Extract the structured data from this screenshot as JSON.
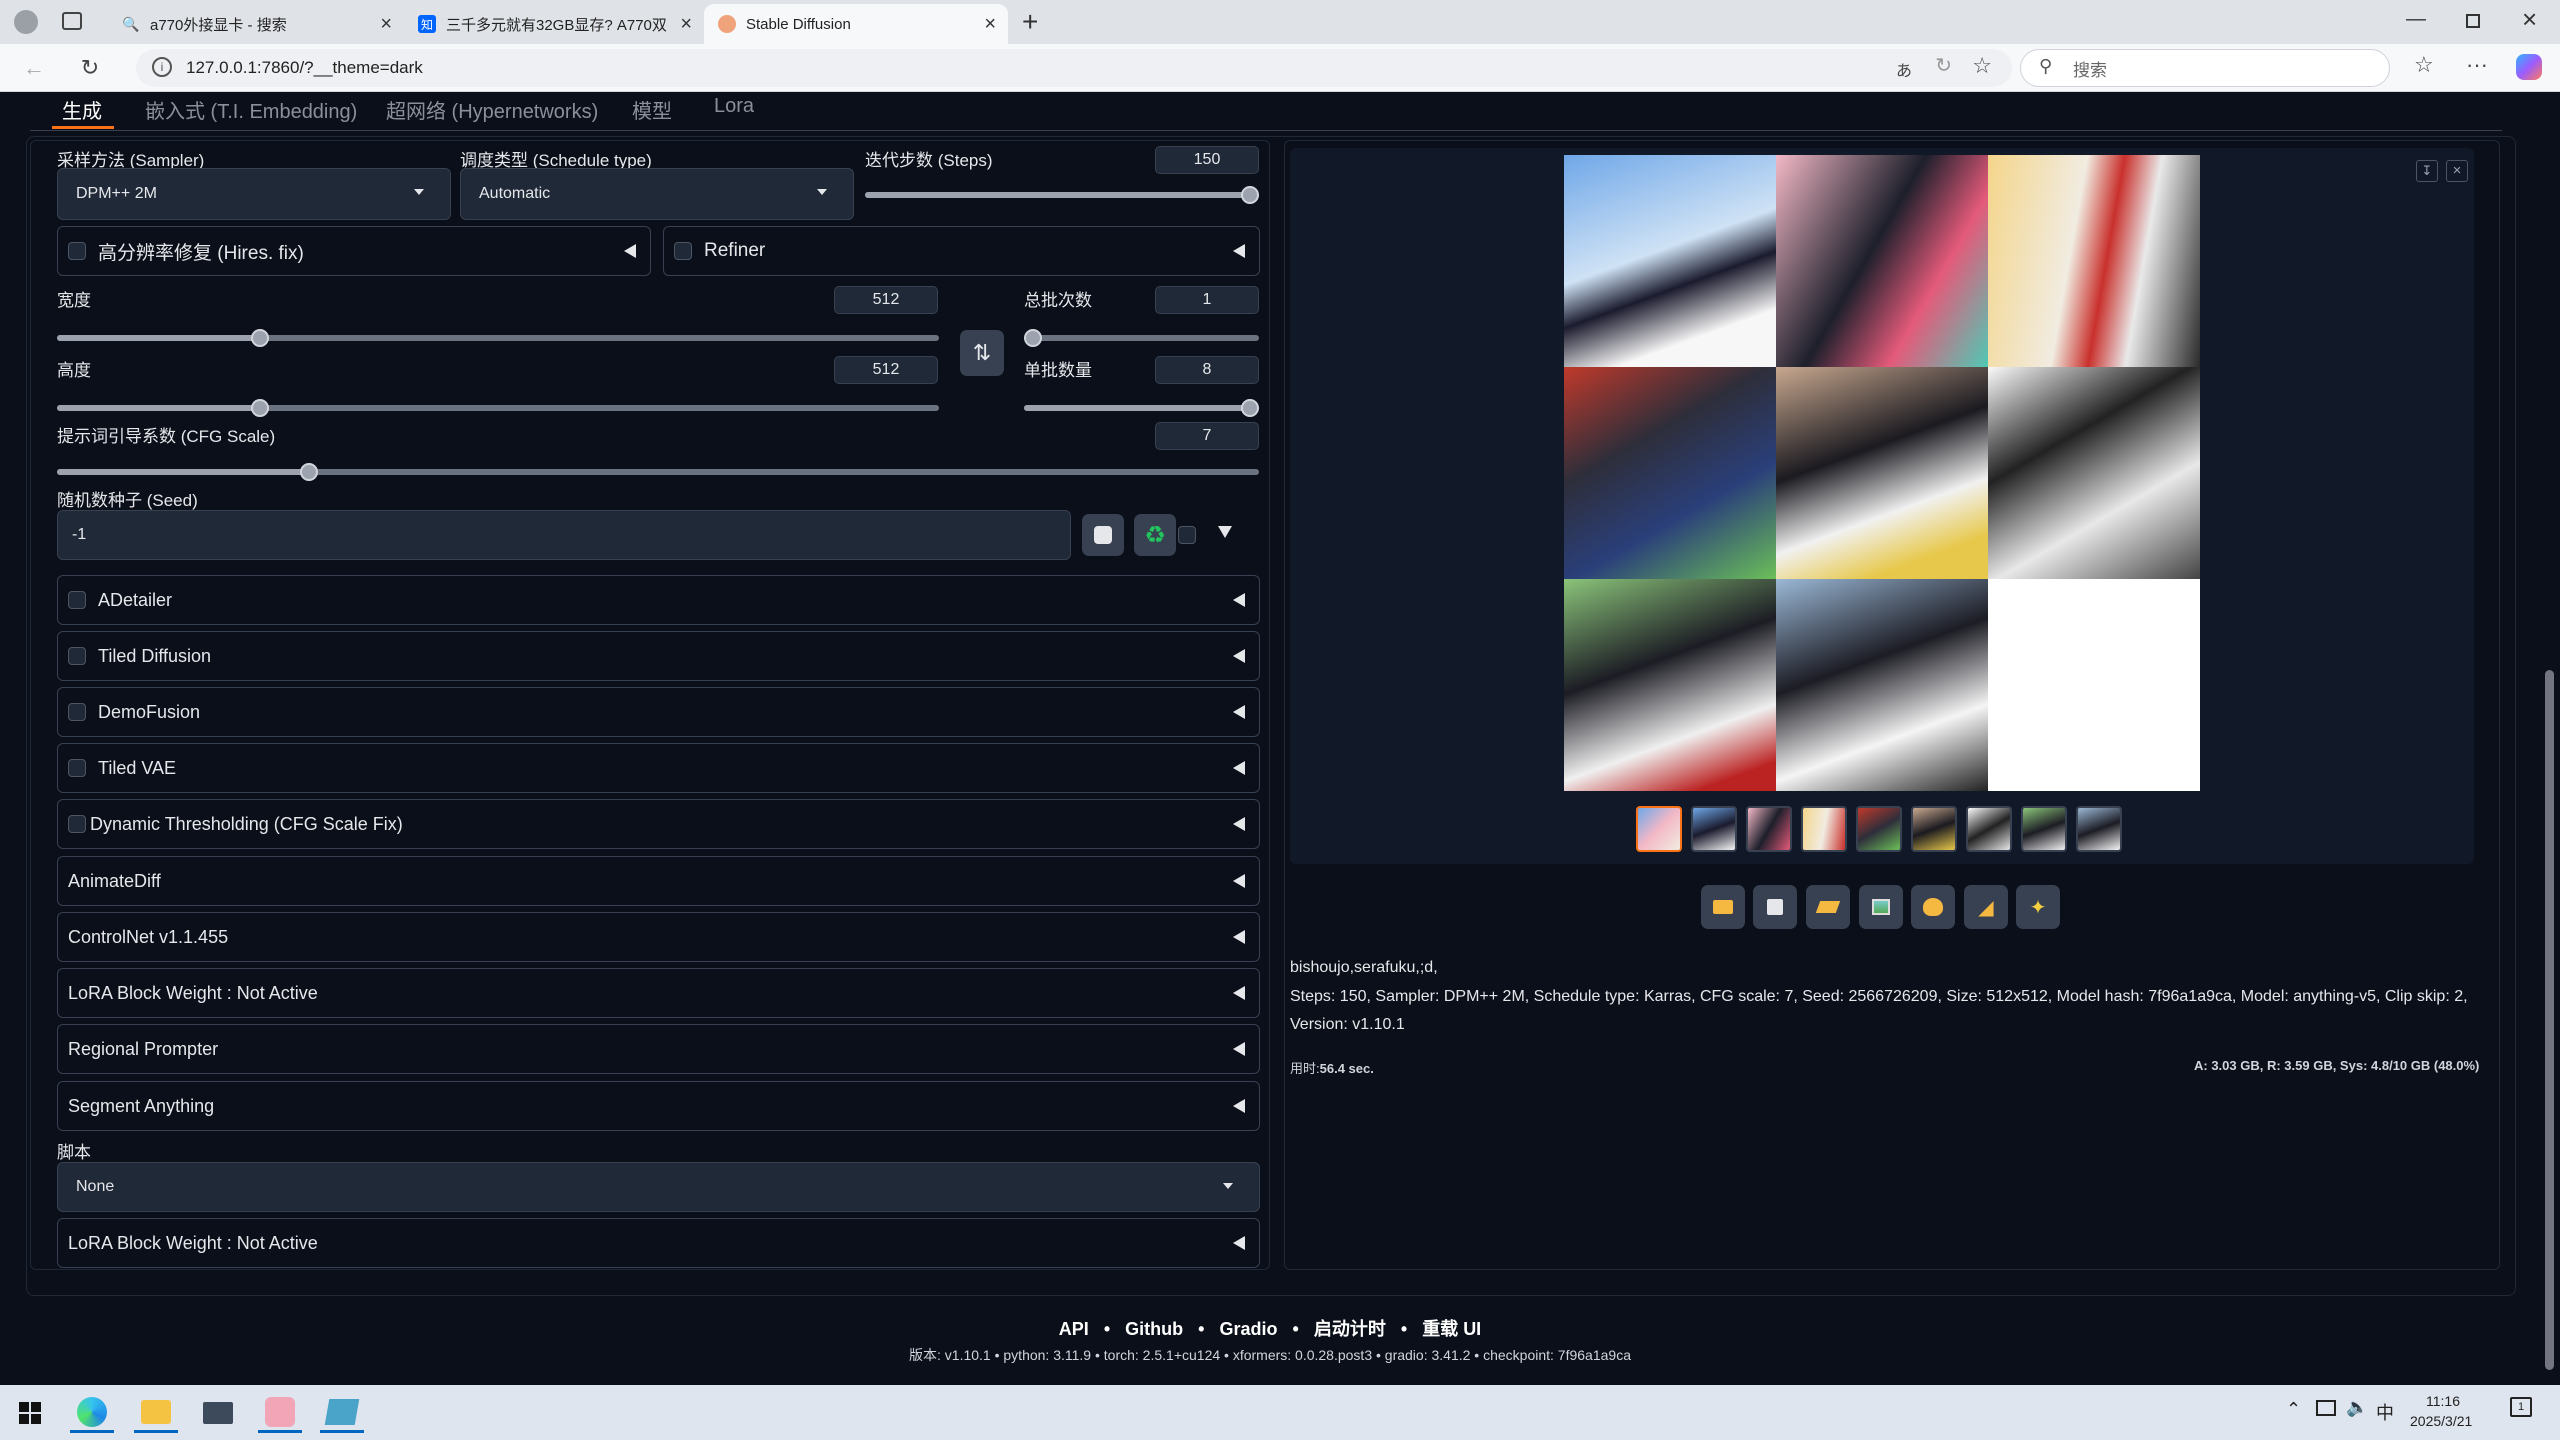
{
  "browser": {
    "tabs": [
      {
        "title": "a770外接显卡 - 搜索",
        "icon": "search-favicon"
      },
      {
        "title": "三千多元就有32GB显存? A770双",
        "icon": "zhihu-favicon"
      },
      {
        "title": "Stable Diffusion",
        "icon": "sd-favicon"
      }
    ],
    "url": "127.0.0.1:7860/?__theme=dark",
    "search_placeholder": "搜索"
  },
  "subtabs": [
    "生成",
    "嵌入式 (T.I. Embedding)",
    "超网络 (Hypernetworks)",
    "模型",
    "Lora"
  ],
  "sampler": {
    "label": "采样方法 (Sampler)",
    "value": "DPM++ 2M"
  },
  "schedule": {
    "label": "调度类型 (Schedule type)",
    "value": "Automatic"
  },
  "steps": {
    "label": "迭代步数 (Steps)",
    "value": "150",
    "fraction": 1.0
  },
  "hires": {
    "label": "高分辨率修复 (Hires. fix)"
  },
  "refiner": {
    "label": "Refiner"
  },
  "width": {
    "label": "宽度",
    "value": "512",
    "fraction": 0.23
  },
  "height": {
    "label": "高度",
    "value": "512",
    "fraction": 0.23
  },
  "batch_count": {
    "label": "总批次数",
    "value": "1",
    "fraction": 0.0
  },
  "batch_size": {
    "label": "单批数量",
    "value": "8",
    "fraction": 1.0
  },
  "cfg": {
    "label": "提示词引导系数 (CFG Scale)",
    "value": "7",
    "fraction": 0.21
  },
  "seed": {
    "label": "随机数种子 (Seed)",
    "value": "-1"
  },
  "accordions": [
    {
      "label": "ADetailer",
      "checkbox": true
    },
    {
      "label": "Tiled Diffusion",
      "checkbox": true
    },
    {
      "label": "DemoFusion",
      "checkbox": true
    },
    {
      "label": "Tiled VAE",
      "checkbox": true
    },
    {
      "label": "Dynamic Thresholding (CFG Scale Fix)",
      "checkbox": true
    },
    {
      "label": "AnimateDiff",
      "checkbox": false
    },
    {
      "label": "ControlNet v1.1.455",
      "checkbox": false
    },
    {
      "label": "LoRA Block Weight : Not Active",
      "checkbox": false
    },
    {
      "label": "Regional Prompter",
      "checkbox": false
    },
    {
      "label": "Segment Anything",
      "checkbox": false
    }
  ],
  "script": {
    "label": "脚本",
    "value": "None"
  },
  "lora_block_bottom": "LoRA Block Weight : Not Active",
  "output": {
    "prompt": "bishoujo,serafuku,;d,",
    "params_line1": "Steps: 150, Sampler: DPM++ 2M, Schedule type: Karras, CFG scale: 7, Seed: 2566726209, Size: 512x512, Model hash: 7f96a1a9ca, Model: anything-v5, Clip skip: 2,",
    "params_line2": "Version: v1.10.1",
    "time_label": "用时:",
    "time_value": "56.4 sec.",
    "vram": "A: 3.03 GB, R: 3.59 GB, Sys: 4.8/10 GB (48.0%)"
  },
  "tool_buttons": [
    "folder-icon",
    "save-icon",
    "zip-icon",
    "img2img-icon",
    "inpaint-icon",
    "extras-icon",
    "sparkle-icon"
  ],
  "footer": {
    "links": [
      "API",
      "Github",
      "Gradio",
      "启动计时",
      "重载 UI"
    ],
    "version": "版本: v1.10.1  •  python: 3.11.9  •  torch: 2.5.1+cu124  •  xformers: 0.0.28.post3  •  gradio: 3.41.2  •  checkpoint: 7f96a1a9ca"
  },
  "taskbar": {
    "time": "11:16",
    "date": "2025/3/21",
    "ime": "中",
    "notifications": "1"
  },
  "colors": {
    "bg": "#0b0f19",
    "panel": "#1f2937",
    "border": "#374151",
    "accent": "#f97316"
  }
}
